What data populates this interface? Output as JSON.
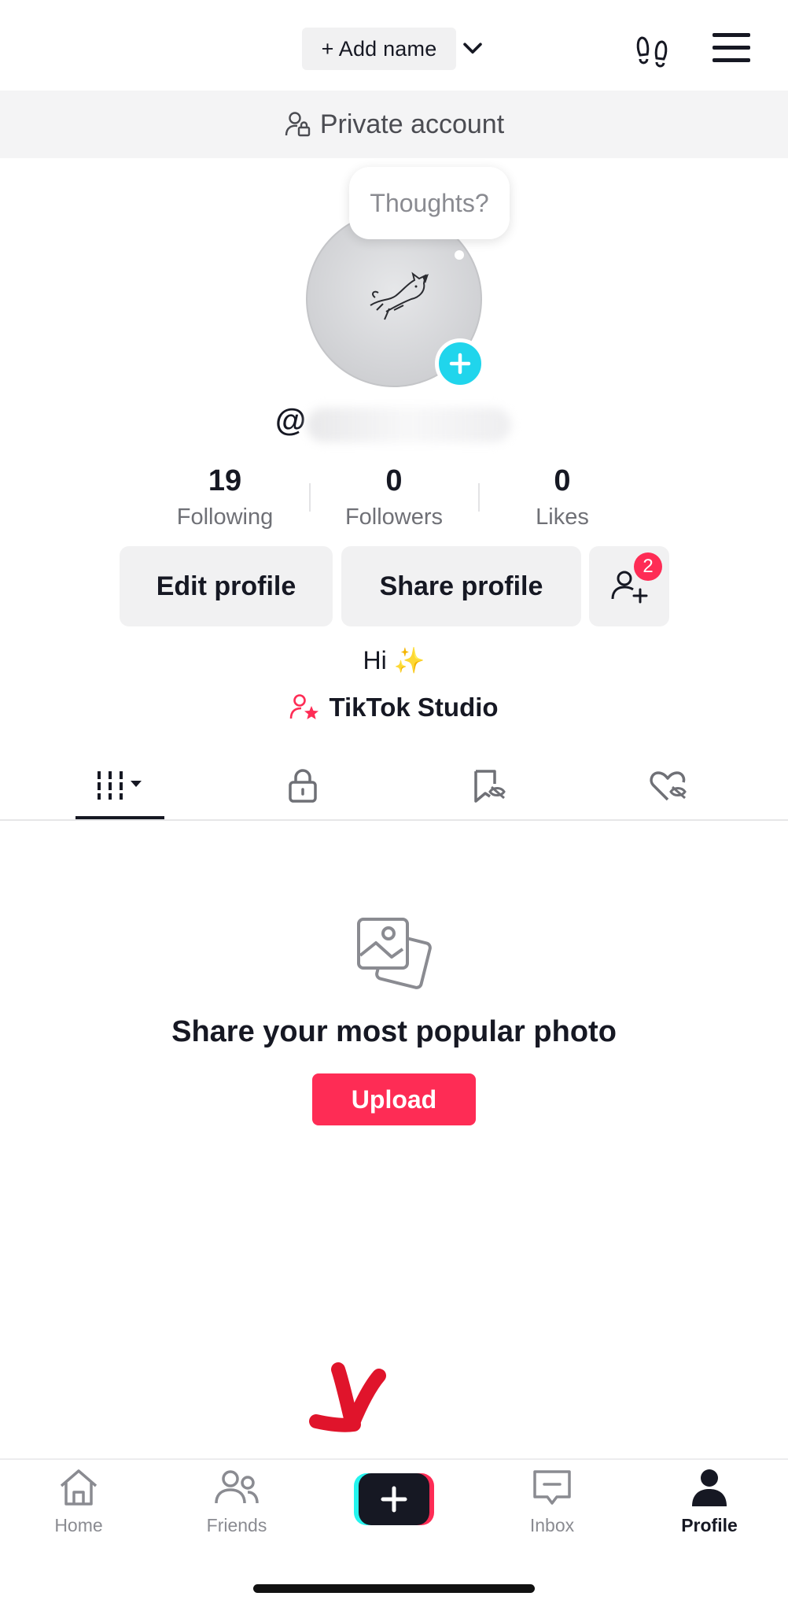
{
  "header": {
    "add_name_label": "+ Add name",
    "dropdown_icon": "chevron-down-icon",
    "footsteps_icon": "footsteps-icon",
    "menu_icon": "hamburger-menu-icon"
  },
  "privacy": {
    "label": "Private account",
    "icon": "user-lock-icon"
  },
  "avatar": {
    "thought_bubble": "Thoughts?",
    "add_icon": "plus-icon"
  },
  "profile": {
    "username_prefix": "@"
  },
  "stats": [
    {
      "value": "19",
      "label": "Following"
    },
    {
      "value": "0",
      "label": "Followers"
    },
    {
      "value": "0",
      "label": "Likes"
    }
  ],
  "actions": {
    "edit_label": "Edit profile",
    "share_label": "Share profile",
    "add_friends_badge": "2"
  },
  "bio": {
    "text": "Hi ✨"
  },
  "studio": {
    "label": "TikTok Studio"
  },
  "tabs": [
    {
      "name": "videos",
      "icon": "grid-filter-icon",
      "active": true
    },
    {
      "name": "private",
      "icon": "lock-icon"
    },
    {
      "name": "reposts",
      "icon": "hidden-bookmark-icon"
    },
    {
      "name": "liked",
      "icon": "hidden-heart-icon"
    }
  ],
  "empty_state": {
    "title": "Share your most popular photo",
    "button_label": "Upload"
  },
  "bottom_nav": [
    {
      "label": "Home",
      "icon": "home-icon"
    },
    {
      "label": "Friends",
      "icon": "friends-icon"
    },
    {
      "label": "",
      "icon": "create-plus-icon"
    },
    {
      "label": "Inbox",
      "icon": "inbox-icon"
    },
    {
      "label": "Profile",
      "icon": "profile-icon",
      "active": true
    }
  ],
  "colors": {
    "accent": "#fe2c55",
    "cyan": "#20d5ec",
    "text": "#161823",
    "muted": "#8a8b91"
  }
}
